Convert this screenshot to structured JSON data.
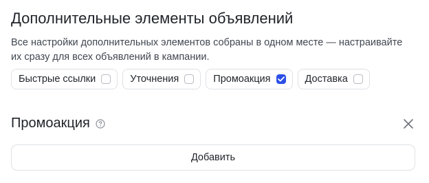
{
  "header": {
    "title": "Дополнительные элементы объявлений",
    "description": "Все настройки дополнительных элементов собраны в одном месте — настраивайте их сразу для всех объявлений в кампании."
  },
  "chips": [
    {
      "label": "Быстрые ссылки",
      "checked": false
    },
    {
      "label": "Уточнения",
      "checked": false
    },
    {
      "label": "Промоакция",
      "checked": true
    },
    {
      "label": "Доставка",
      "checked": false
    }
  ],
  "section": {
    "title": "Промоакция",
    "help_icon": "question-circle-icon",
    "close_icon": "close-icon",
    "add_label": "Добавить"
  },
  "colors": {
    "accent": "#2d50e6",
    "border": "#dfe1e5",
    "text": "#1f2329"
  }
}
